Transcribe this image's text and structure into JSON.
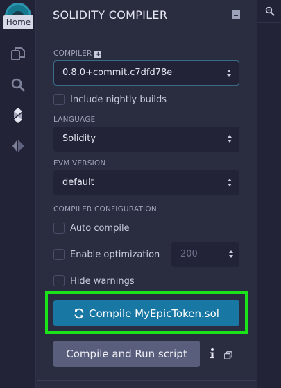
{
  "rail": {
    "tooltip": "Home",
    "icons": [
      "remix-logo-icon",
      "file-explorer-icon",
      "search-icon",
      "solidity-compiler-icon",
      "deploy-run-icon"
    ]
  },
  "right_strip": {
    "icon": "zoom-icon"
  },
  "panel": {
    "title": "SOLIDITY COMPILER",
    "compiler_label": "COMPILER",
    "compiler_value": "0.8.0+commit.c7dfd78e",
    "nightly_label": "Include nightly builds",
    "language_label": "LANGUAGE",
    "language_value": "Solidity",
    "evm_label": "EVM VERSION",
    "evm_value": "default",
    "config_label": "COMPILER CONFIGURATION",
    "auto_compile_label": "Auto compile",
    "optimization_label": "Enable optimization",
    "runs_value": "200",
    "hide_warnings_label": "Hide warnings",
    "compile_button": "Compile MyEpicToken.sol",
    "run_script_button": "Compile and Run script"
  },
  "colors": {
    "background": "#2a2c3f",
    "rail": "#222336",
    "compile_button": "#1877a3",
    "highlight": "#1be319",
    "secondary_button": "#595e7d"
  }
}
